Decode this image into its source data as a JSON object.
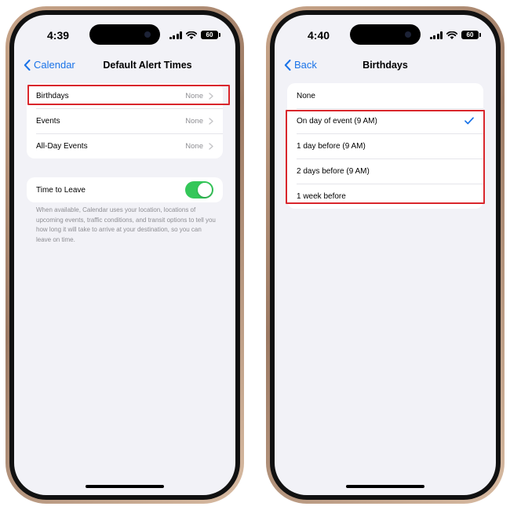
{
  "left_phone": {
    "status": {
      "time": "4:39",
      "battery": "60"
    },
    "nav": {
      "back_label": "Calendar",
      "title": "Default Alert Times"
    },
    "alert_rows": [
      {
        "label": "Birthdays",
        "value": "None"
      },
      {
        "label": "Events",
        "value": "None"
      },
      {
        "label": "All-Day Events",
        "value": "None"
      }
    ],
    "time_to_leave": {
      "label": "Time to Leave",
      "enabled": true,
      "footnote": "When available, Calendar uses your location, locations of upcoming events, traffic conditions, and transit options to tell you how long it will take to arrive at your destination, so you can leave on time."
    }
  },
  "right_phone": {
    "status": {
      "time": "4:40",
      "battery": "60"
    },
    "nav": {
      "back_label": "Back",
      "title": "Birthdays"
    },
    "options": [
      {
        "label": "None",
        "selected": false
      },
      {
        "label": "On day of event (9 AM)",
        "selected": true
      },
      {
        "label": "1 day before (9 AM)",
        "selected": false
      },
      {
        "label": "2 days before (9 AM)",
        "selected": false
      },
      {
        "label": "1 week before",
        "selected": false
      }
    ]
  },
  "colors": {
    "accent": "#1a73e8",
    "toggle_on": "#34c759",
    "highlight": "#d9262c",
    "background": "#f2f2f7"
  }
}
